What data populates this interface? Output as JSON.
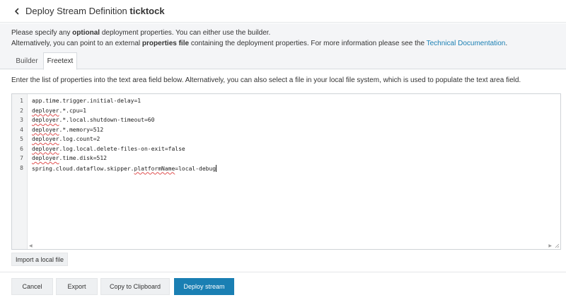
{
  "header": {
    "title_prefix": "Deploy Stream Definition",
    "stream_name": "ticktock",
    "back_icon": "chevron-left-icon"
  },
  "intro": {
    "line1_a": "Please specify any ",
    "line1_bold": "optional",
    "line1_b": " deployment properties. You can either use the builder.",
    "line2_a": "Alternatively, you can point to an external ",
    "line2_bold": "properties file",
    "line2_b": " containing the deployment properties. For more information please see the ",
    "link": "Technical Documentation",
    "line2_end": "."
  },
  "tabs": [
    {
      "label": "Builder",
      "active": false
    },
    {
      "label": "Freetext",
      "active": true
    }
  ],
  "instruction": "Enter the list of properties into the text area field below. Alternatively, you can also select a file in your local file system, which is used to populate the text area field.",
  "editor": {
    "lines": [
      {
        "num": "1",
        "a": "",
        "s": "",
        "b": "app.time.trigger.initial-delay=1"
      },
      {
        "num": "2",
        "a": "",
        "s": "deployer",
        "b": ".*.cpu=1"
      },
      {
        "num": "3",
        "a": "",
        "s": "deployer",
        "b": ".*.local.shutdown-timeout=60"
      },
      {
        "num": "4",
        "a": "",
        "s": "deployer",
        "b": ".*.memory=512"
      },
      {
        "num": "5",
        "a": "",
        "s": "deployer",
        "b": ".log.count=2"
      },
      {
        "num": "6",
        "a": "",
        "s": "deployer",
        "b": ".log.local.delete-files-on-exit=false"
      },
      {
        "num": "7",
        "a": "",
        "s": "deployer",
        "b": ".time.disk=512"
      },
      {
        "num": "8",
        "a": "spring.cloud.dataflow.skipper.",
        "s": "platformName",
        "b": "=local-debug"
      }
    ]
  },
  "buttons": {
    "import": "Import a local file",
    "cancel": "Cancel",
    "export": "Export",
    "copy": "Copy to Clipboard",
    "deploy": "Deploy stream"
  },
  "colors": {
    "accent": "#1a7fb3",
    "panel": "#f4f5f7"
  }
}
